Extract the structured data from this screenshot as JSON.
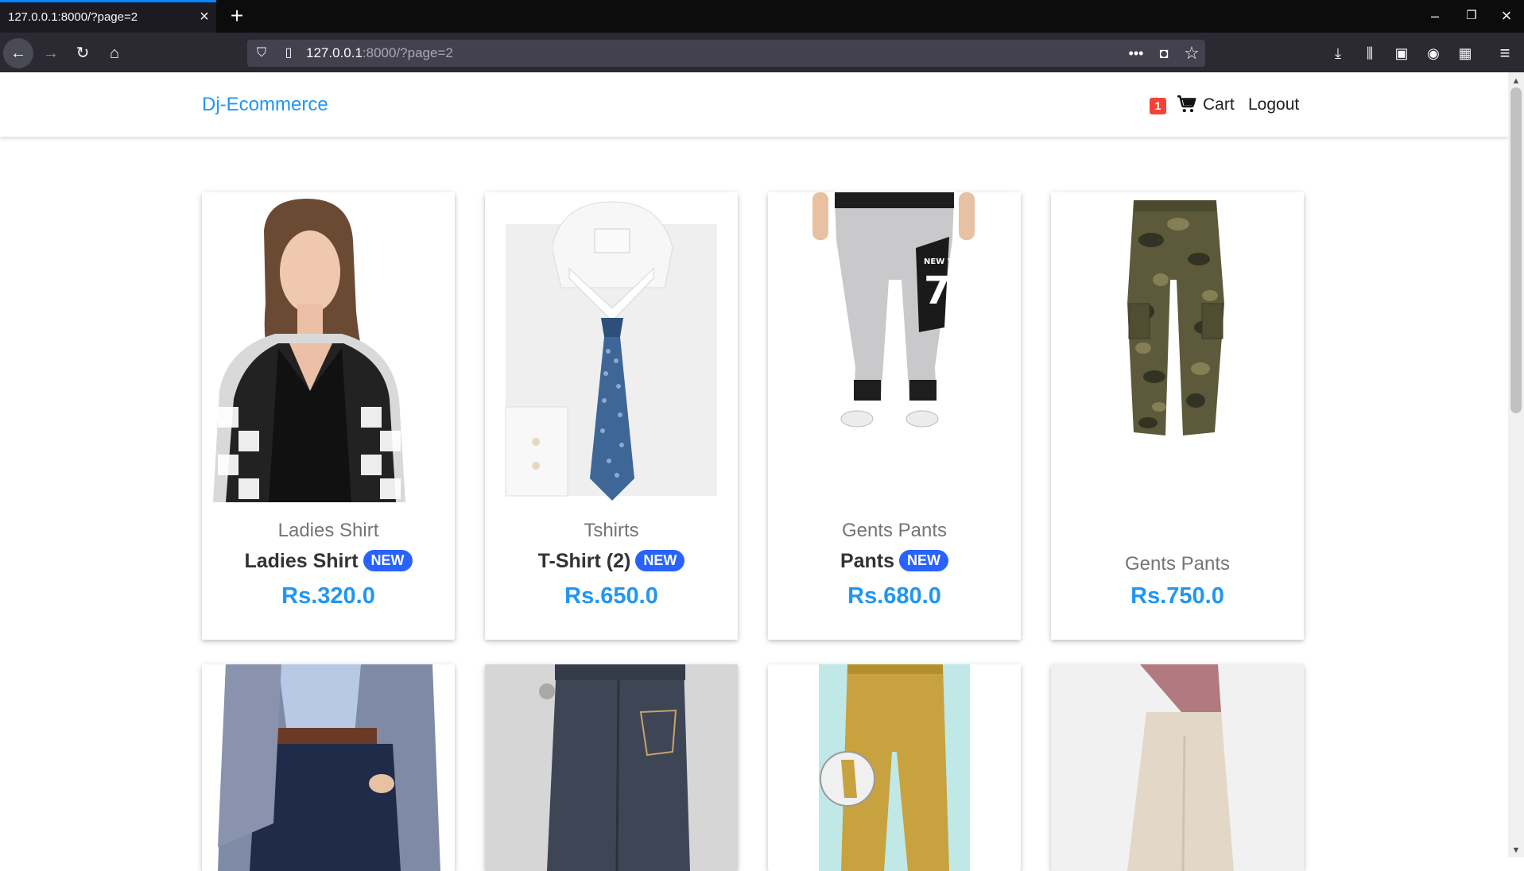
{
  "browser": {
    "tab_title": "127.0.0.1:8000/?page=2",
    "url_host": "127.0.0.1",
    "url_rest": ":8000/?page=2",
    "icons": [
      "back-icon",
      "forward-icon",
      "reload-icon",
      "home-icon",
      "shield-icon",
      "page-icon",
      "more-icon",
      "pocket-icon",
      "star-icon",
      "download-icon",
      "library-icon",
      "sidebar-icon",
      "account-icon",
      "extensions-icon",
      "menu-icon"
    ]
  },
  "site": {
    "brand": "Dj-Ecommerce",
    "cart_count": "1",
    "cart_label": "Cart",
    "logout_label": "Logout",
    "accent_color": "#2196f3",
    "badge_color": "#2962ff"
  },
  "products": [
    {
      "category": "Ladies Shirt",
      "title": "Ladies Shirt",
      "badge": "NEW",
      "price": "Rs.320.0"
    },
    {
      "category": "Tshirts",
      "title": "T-Shirt (2)",
      "badge": "NEW",
      "price": "Rs.650.0"
    },
    {
      "category": "Gents Pants",
      "title": "Pants",
      "badge": "NEW",
      "price": "Rs.680.0"
    },
    {
      "category": "Gents Pants",
      "title": "",
      "badge": "",
      "price": "Rs.750.0"
    }
  ]
}
